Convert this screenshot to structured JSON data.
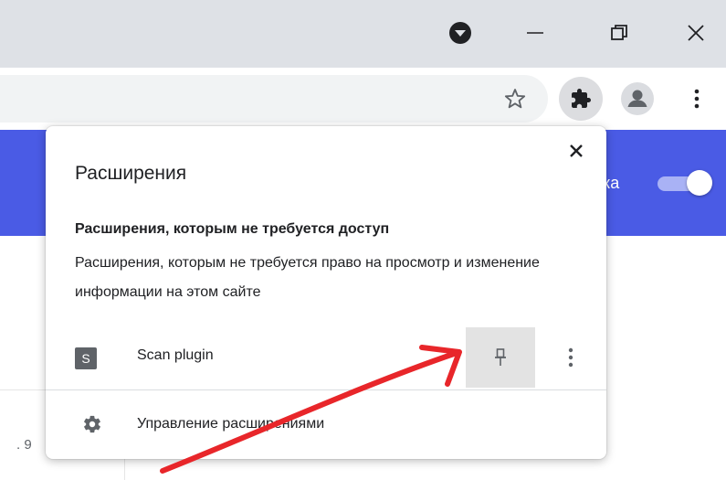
{
  "window": {
    "profile_icon": "chevron-down-circle-icon",
    "minimize_icon": "minimize-icon",
    "restore_icon": "restore-icon",
    "close_icon": "close-icon"
  },
  "toolbar": {
    "bookmark_icon": "star-icon",
    "extensions_icon": "puzzle-icon",
    "profile_icon": "avatar-icon",
    "menu_icon": "kebab-menu-icon"
  },
  "page": {
    "band_text": "ка",
    "side_fragment": ". 9",
    "accent_color": "#4a5be5"
  },
  "popup": {
    "title": "Расширения",
    "section_heading": "Расширения, которым не требуется доступ",
    "section_description": "Расширения, которым не требуется право на просмотр и изменение информации на этом сайте",
    "extensions": [
      {
        "badge": "S",
        "name": "Scan plugin",
        "pin_icon": "pin-icon",
        "menu_icon": "kebab-menu-icon"
      }
    ],
    "manage_label": "Управление расширениями",
    "manage_icon": "gear-icon",
    "close_icon": "close-icon"
  },
  "annotation": {
    "arrow_color": "#e8262a"
  }
}
